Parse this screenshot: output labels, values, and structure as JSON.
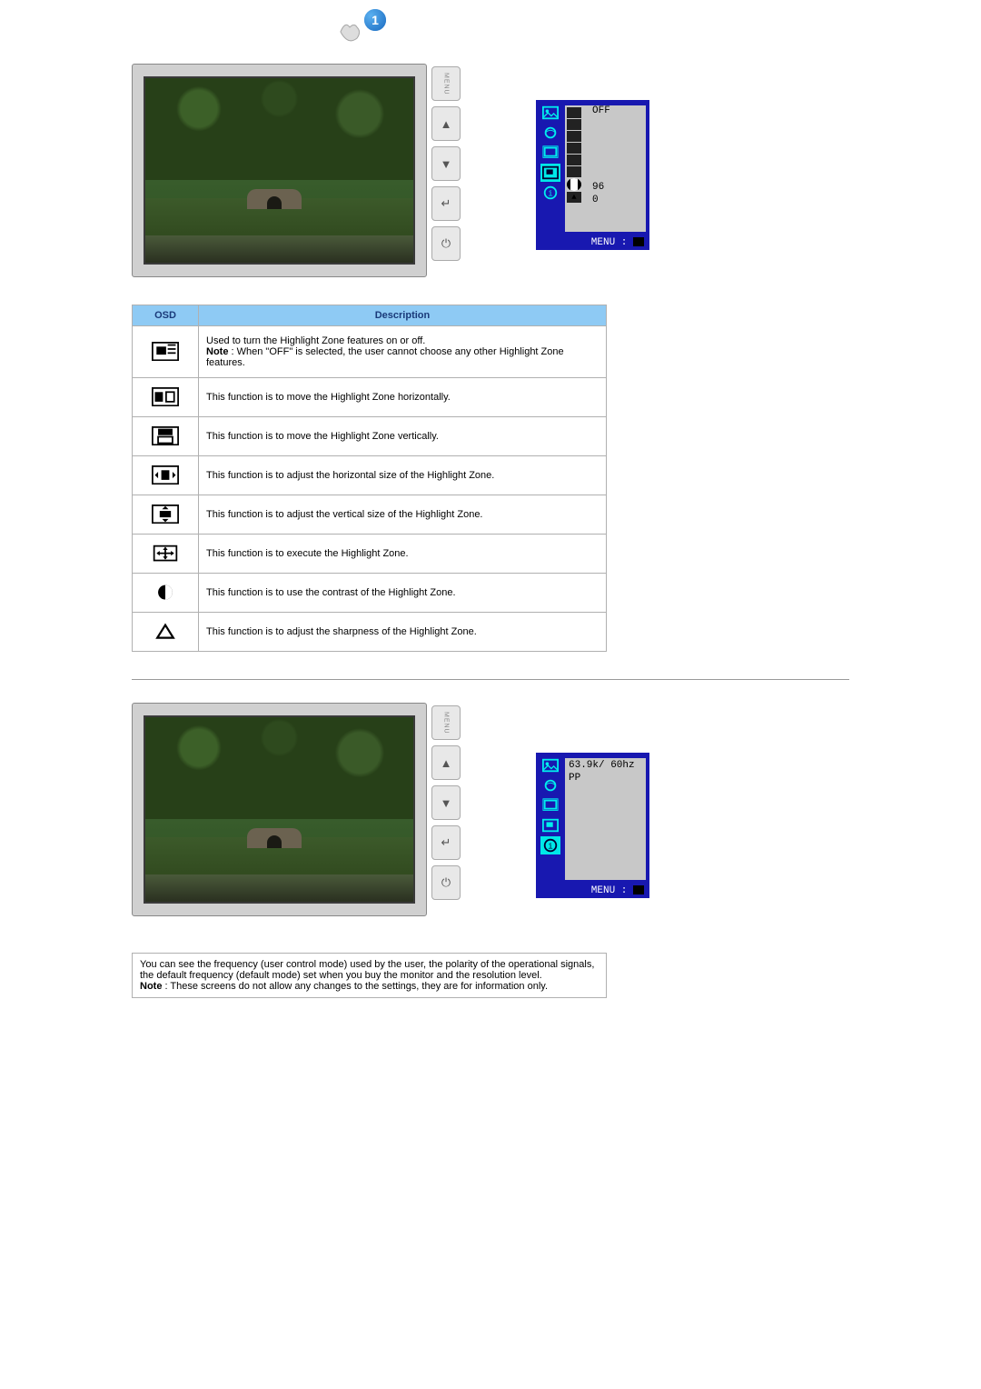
{
  "section1": {
    "osd_panel": {
      "left_active_index": 3,
      "values": {
        "off": "OFF",
        "contrast": "96",
        "sharpness": "0"
      },
      "footer": "MENU :"
    },
    "table": {
      "headers": {
        "osd": "OSD",
        "description": "Description"
      },
      "rows": [
        {
          "icon": "hz-toggle",
          "text": "Used to turn the Highlight Zone features on or off.",
          "note_label": "Note",
          "note": " : When \"OFF\" is selected, the user cannot choose any other Highlight Zone features."
        },
        {
          "icon": "hz-h-move",
          "text": "This function is to move the Highlight Zone horizontally."
        },
        {
          "icon": "hz-v-move",
          "text": "This function is to move the Highlight Zone vertically."
        },
        {
          "icon": "hz-h-size",
          "text": "This function is to adjust the horizontal size of the Highlight Zone."
        },
        {
          "icon": "hz-v-size",
          "text": "This function is to adjust the vertical size of the Highlight Zone."
        },
        {
          "icon": "hz-execute",
          "text": "This function is to execute the Highlight Zone."
        },
        {
          "icon": "hz-contrast",
          "text": "This function is to use the contrast of the Highlight Zone."
        },
        {
          "icon": "hz-sharpness",
          "text": "This function is to adjust the sharpness of the Highlight Zone."
        }
      ]
    }
  },
  "section2": {
    "osd_panel": {
      "left_active_index": 4,
      "value_line1": "63.9k/ 60hz",
      "value_line2": "PP",
      "footer": "MENU :"
    },
    "info": {
      "text": "You can see the frequency (user control mode) used by the user, the polarity of the operational signals, the default frequency (default mode) set when you buy the monitor and the resolution level.",
      "note_label": "Note",
      "note": " : These screens do not allow any changes to the settings, they are for information only."
    }
  },
  "badge_number": "1",
  "menu_label": "MENU"
}
